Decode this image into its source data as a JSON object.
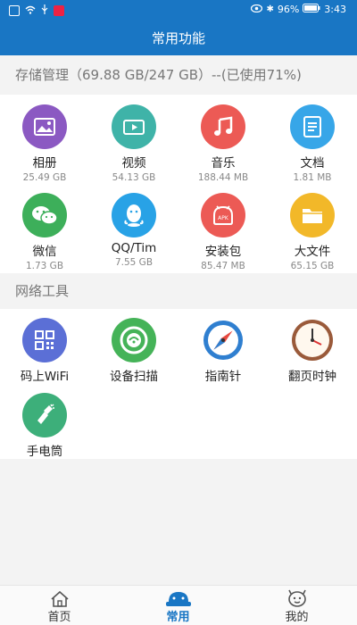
{
  "status_bar": {
    "battery": "96%",
    "time": "3:43"
  },
  "header": {
    "title": "常用功能"
  },
  "storage": {
    "title": "存储管理（69.88 GB/247 GB）--(已使用71%)",
    "items": [
      {
        "label": "相册",
        "size": "25.49 GB",
        "icon": "photo-icon",
        "color": "#8b59c2"
      },
      {
        "label": "视频",
        "size": "54.13 GB",
        "icon": "video-icon",
        "color": "#3fb3a8"
      },
      {
        "label": "音乐",
        "size": "188.44 MB",
        "icon": "music-icon",
        "color": "#ec5a55"
      },
      {
        "label": "文档",
        "size": "1.81 MB",
        "icon": "document-icon",
        "color": "#37a6e8"
      },
      {
        "label": "微信",
        "size": "1.73 GB",
        "icon": "wechat-icon",
        "color": "#3daf5a"
      },
      {
        "label": "QQ/Tim",
        "size": "7.55 GB",
        "icon": "qq-icon",
        "color": "#28a2e6"
      },
      {
        "label": "安装包",
        "size": "85.47 MB",
        "icon": "apk-icon",
        "color": "#ec5a55"
      },
      {
        "label": "大文件",
        "size": "65.15 GB",
        "icon": "folder-icon",
        "color": "#f2b829"
      }
    ]
  },
  "network": {
    "title": "网络工具",
    "items": [
      {
        "label": "码上WiFi",
        "icon": "qr-code-icon",
        "color": "#5b6fd6"
      },
      {
        "label": "设备扫描",
        "icon": "device-scan-icon",
        "color": "#45b358"
      },
      {
        "label": "指南针",
        "icon": "compass-icon",
        "color": "#2f7fd0"
      },
      {
        "label": "翻页时钟",
        "icon": "clock-icon",
        "color": "#9a5a3a"
      },
      {
        "label": "手电筒",
        "icon": "flashlight-icon",
        "color": "#3daf7a"
      }
    ]
  },
  "tabs": [
    {
      "label": "首页",
      "icon": "home-icon",
      "active": false
    },
    {
      "label": "常用",
      "icon": "toolbox-icon",
      "active": true
    },
    {
      "label": "我的",
      "icon": "profile-icon",
      "active": false
    }
  ],
  "colors": {
    "primary": "#1976c4",
    "background": "#f3f3f3"
  }
}
